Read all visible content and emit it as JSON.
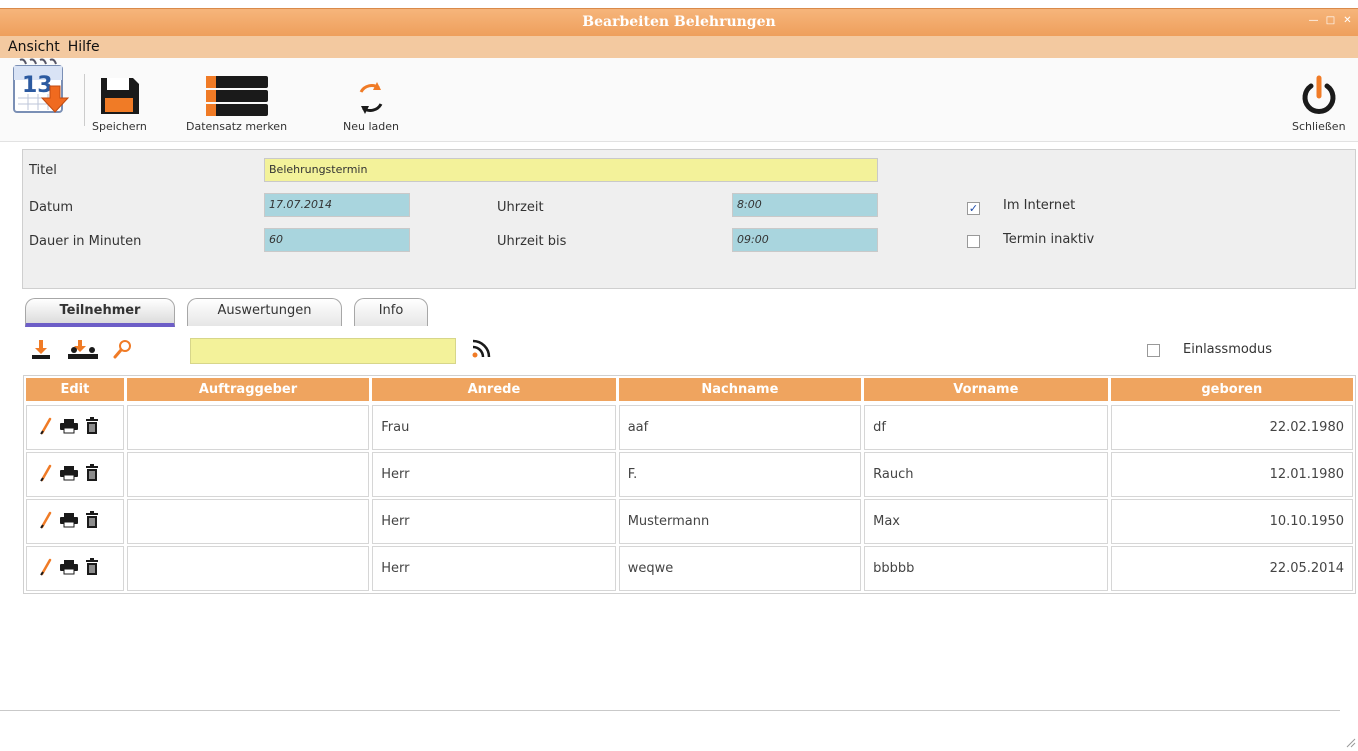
{
  "window": {
    "title": "Bearbeiten Belehrungen"
  },
  "menu": [
    "Ansicht",
    "Hilfe"
  ],
  "toolbar": {
    "save": "Speichern",
    "bookmark": "Datensatz merken",
    "reload": "Neu laden",
    "close": "Schließen"
  },
  "form": {
    "titel_label": "Titel",
    "titel_value": "Belehrungstermin",
    "datum_label": "Datum",
    "datum_value": "17.07.2014",
    "uhrzeit_label": "Uhrzeit",
    "uhrzeit_value": "8:00",
    "dauer_label": "Dauer in Minuten",
    "dauer_value": "60",
    "uhrzeit_bis_label": "Uhrzeit bis",
    "uhrzeit_bis_value": "09:00",
    "internet_label": "Im Internet",
    "internet_checked": true,
    "inaktiv_label": "Termin inaktiv",
    "inaktiv_checked": false
  },
  "tabs": [
    {
      "label": "Teilnehmer",
      "active": true
    },
    {
      "label": "Auswertungen",
      "active": false
    },
    {
      "label": "Info",
      "active": false
    }
  ],
  "filter": {
    "search_value": "",
    "einlass_label": "Einlassmodus",
    "einlass_checked": false
  },
  "table": {
    "headers": [
      "Edit",
      "Auftraggeber",
      "Anrede",
      "Nachname",
      "Vorname",
      "geboren"
    ],
    "rows": [
      {
        "auftraggeber": "",
        "anrede": "Frau",
        "nachname": "aaf",
        "vorname": "df",
        "geboren": "22.02.1980"
      },
      {
        "auftraggeber": "",
        "anrede": "Herr",
        "nachname": "F.",
        "vorname": "Rauch",
        "geboren": "12.01.1980"
      },
      {
        "auftraggeber": "",
        "anrede": "Herr",
        "nachname": "Mustermann",
        "vorname": "Max",
        "geboren": "10.10.1950"
      },
      {
        "auftraggeber": "",
        "anrede": "Herr",
        "nachname": "weqwe",
        "vorname": "bbbbb",
        "geboren": "22.05.2014"
      }
    ]
  },
  "colors": {
    "accent": "#efa45f",
    "title_bar": "#f0a461",
    "menu_bar": "#f3c9a0",
    "field_yellow": "#f3f29a",
    "field_blue": "#a9d5de"
  }
}
